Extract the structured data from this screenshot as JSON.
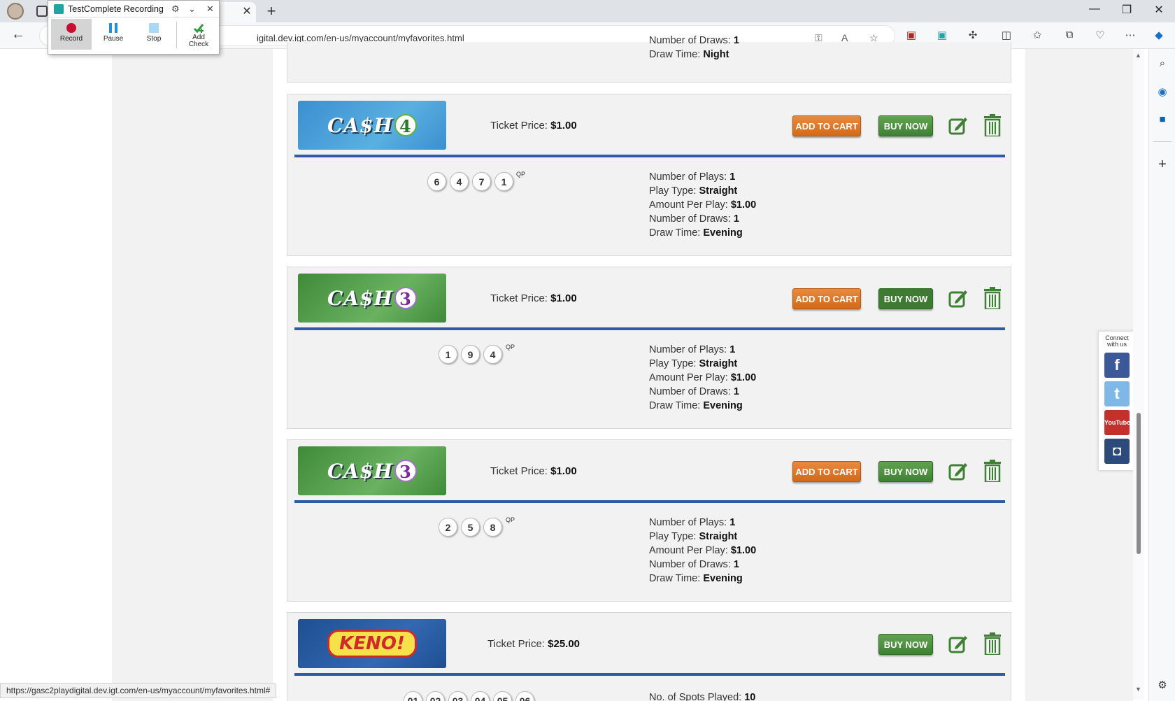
{
  "browser": {
    "url": "gasc2playdigital.dev.igt.com/en-us/myaccount/myfavorites.html",
    "url_visible": "igital.dev.igt.com/en-us/myaccount/myfavorites.html",
    "status_url": "https://gasc2playdigital.dev.igt.com/en-us/myaccount/myfavorites.html#"
  },
  "recorder": {
    "title": "TestComplete Recording",
    "buttons": [
      {
        "label": "Record"
      },
      {
        "label": "Pause"
      },
      {
        "label": "Stop"
      },
      {
        "label": "Add Check",
        "line1": "Add",
        "line2": "Check"
      }
    ]
  },
  "partial_card": {
    "line1_label": "Number of Draws:",
    "line1_value": "1",
    "line2_label": "Draw Time:",
    "line2_value": "Night"
  },
  "labels": {
    "ticket_price": "Ticket Price:",
    "add_to_cart": "ADD TO CART",
    "buy_now": "BUY NOW",
    "qp": "QP",
    "plays": "Number of Plays:",
    "play_type": "Play Type:",
    "amount": "Amount Per Play:",
    "draws": "Number of Draws:",
    "draw_time": "Draw Time:",
    "spots": "No. of Spots Played:"
  },
  "favorites": [
    {
      "game": "Cash 4",
      "logo_text": "CA$H",
      "logo_num": "4",
      "price": "$1.00",
      "numbers": [
        "6",
        "4",
        "7",
        "1"
      ],
      "plays": "1",
      "play_type": "Straight",
      "amount": "$1.00",
      "draws": "1",
      "draw_time": "Evening"
    },
    {
      "game": "Cash 3",
      "logo_text": "CA$H",
      "logo_num": "3",
      "price": "$1.00",
      "numbers": [
        "1",
        "9",
        "4"
      ],
      "plays": "1",
      "play_type": "Straight",
      "amount": "$1.00",
      "draws": "1",
      "draw_time": "Evening"
    },
    {
      "game": "Cash 3",
      "logo_text": "CA$H",
      "logo_num": "3",
      "price": "$1.00",
      "numbers": [
        "2",
        "5",
        "8"
      ],
      "plays": "1",
      "play_type": "Straight",
      "amount": "$1.00",
      "draws": "1",
      "draw_time": "Evening"
    },
    {
      "game": "Keno",
      "logo_text": "KENO!",
      "price": "$25.00",
      "numbers": [
        "01",
        "02",
        "03",
        "04",
        "05",
        "06"
      ],
      "spots": "10"
    }
  ],
  "connect": {
    "title_line1": "Connect",
    "title_line2": "with us",
    "youtube": "YouTube"
  },
  "colors": {
    "divider": "#2e5aa8",
    "add_to_cart": "#d26a1a",
    "buy_now": "#3f8134",
    "facebook": "#3b5998",
    "twitter": "#55acee",
    "youtube": "#c4302b",
    "instagram": "#2c4a7a"
  }
}
